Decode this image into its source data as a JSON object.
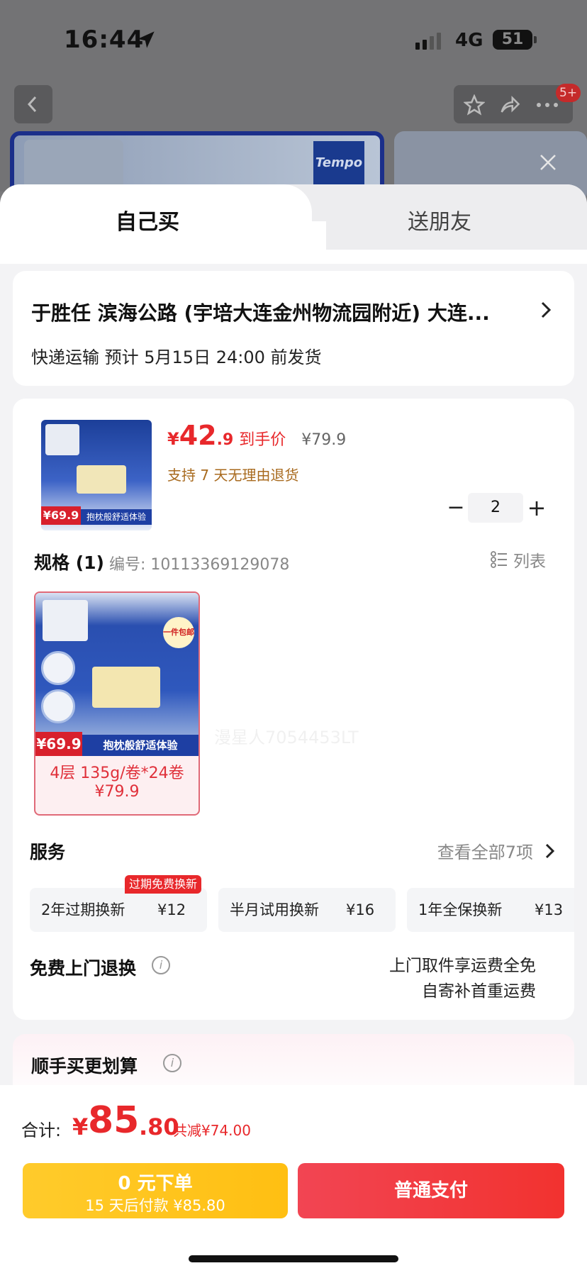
{
  "status_bar": {
    "time": "16:44",
    "network": "4G",
    "battery": "51"
  },
  "background": {
    "badge": "5+",
    "brand_logo": "Tempo"
  },
  "tabs": [
    {
      "label": "自己买",
      "active": true
    },
    {
      "label": "送朋友",
      "active": false
    }
  ],
  "address": {
    "line": "于胜任  滨海公路 (宇培大连金州物流园附近) 大连...",
    "shipping": "快递运输 预计 5月15日 24:00 前发货"
  },
  "product": {
    "price_yen": "¥",
    "price_int": "42",
    "price_dec": ".9",
    "price_label": "到手价",
    "original_price": "¥79.9",
    "return_policy": "支持 7 天无理由退货",
    "quantity": "2",
    "thumb_price": "¥69.9",
    "thumb_banner": "抱枕般舒适体验"
  },
  "spec": {
    "title": "规格 (1)",
    "code": "编号:  10113369129078",
    "list_toggle": "列表",
    "item_name": "4层 135g/卷*24卷",
    "item_price": "¥79.9",
    "item_img_price": "¥69.9",
    "item_img_banner": "抱枕般舒适体验",
    "item_img_stamp": "一件包邮"
  },
  "watermark": "漫星人7054453LT",
  "services": {
    "title": "服务",
    "view_all": "查看全部7项",
    "tag": "过期免费换新",
    "chips": [
      {
        "name": "2年过期换新",
        "price": "¥12"
      },
      {
        "name": "半月试用换新",
        "price": "¥16"
      },
      {
        "name": "1年全保换新",
        "price": "¥13"
      }
    ]
  },
  "free_return": {
    "title": "免费上门退换",
    "desc1": "上门取件享运费全免",
    "desc2": "自寄补首重运费"
  },
  "more": {
    "title": "顺手买更划算"
  },
  "footer": {
    "total_label": "合计:",
    "total_yen": "¥",
    "total_int": "85",
    "total_dec": ".80",
    "total_save": "共减¥74.00",
    "later_line1": "0 元下单",
    "later_line2": "15 天后付款 ¥85.80",
    "pay_label": "普通支付"
  },
  "colors": {
    "accent": "#e8282b",
    "pay_button": "#f2322f",
    "later_button": "#ffc21a"
  }
}
